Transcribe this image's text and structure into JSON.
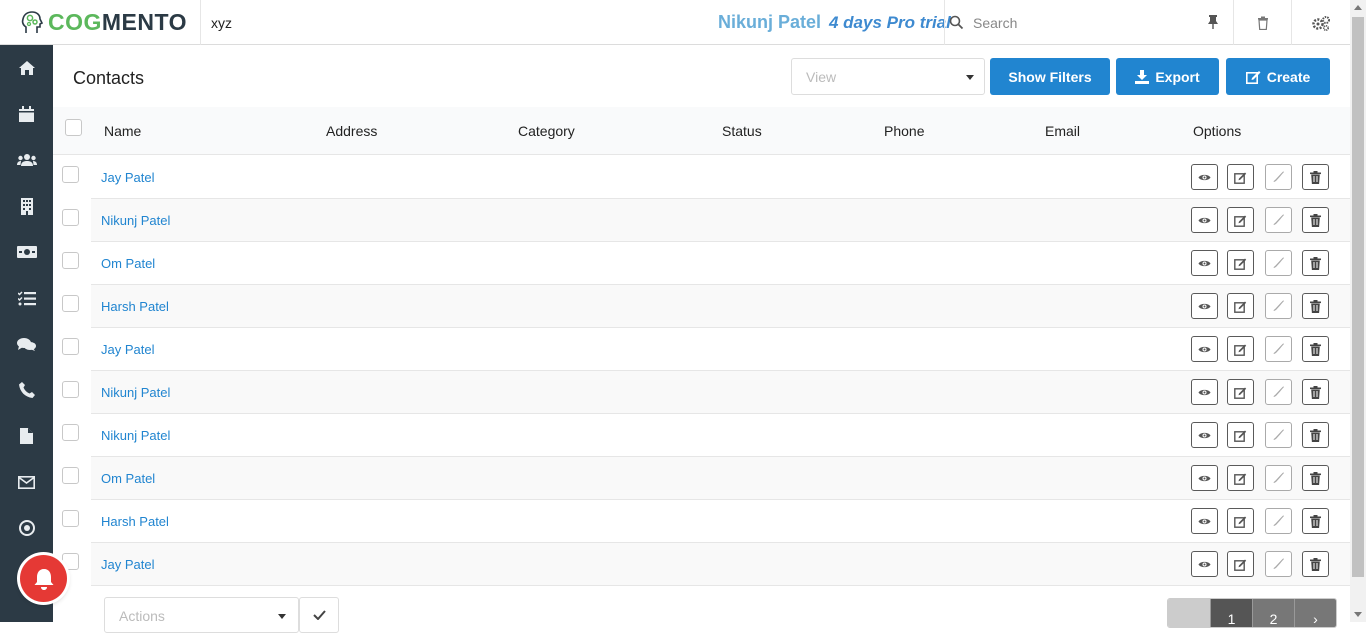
{
  "brand": {
    "logo_part1": "COG",
    "logo_part2": "MENTO"
  },
  "topbar": {
    "account": "xyz",
    "username": "Nikunj Patel",
    "trial": "4 days Pro trial",
    "search_placeholder": "Search"
  },
  "sidebar": {
    "items": [
      {
        "icon": "home-icon"
      },
      {
        "icon": "calendar-icon"
      },
      {
        "icon": "users-icon"
      },
      {
        "icon": "building-icon"
      },
      {
        "icon": "money-icon"
      },
      {
        "icon": "tasks-icon"
      },
      {
        "icon": "comments-icon"
      },
      {
        "icon": "phone-icon"
      },
      {
        "icon": "file-icon"
      },
      {
        "icon": "envelope-icon"
      },
      {
        "icon": "target-icon"
      }
    ]
  },
  "header": {
    "title": "Contacts",
    "view_placeholder": "View",
    "show_filters": "Show Filters",
    "export": "Export",
    "create": "Create"
  },
  "table": {
    "columns": [
      "Name",
      "Address",
      "Category",
      "Status",
      "Phone",
      "Email",
      "Options"
    ],
    "rows": [
      {
        "name": "Jay Patel"
      },
      {
        "name": "Nikunj Patel"
      },
      {
        "name": "Om Patel"
      },
      {
        "name": "Harsh Patel"
      },
      {
        "name": "Jay Patel"
      },
      {
        "name": "Nikunj Patel"
      },
      {
        "name": "Nikunj Patel"
      },
      {
        "name": "Om Patel"
      },
      {
        "name": "Harsh Patel"
      },
      {
        "name": "Jay Patel"
      }
    ]
  },
  "footer": {
    "actions_placeholder": "Actions",
    "pages": [
      "1",
      "2"
    ],
    "next": "›"
  },
  "colors": {
    "primary": "#2185d0",
    "sidebar": "#2c3a45",
    "brand_green": "#5cb85c"
  }
}
